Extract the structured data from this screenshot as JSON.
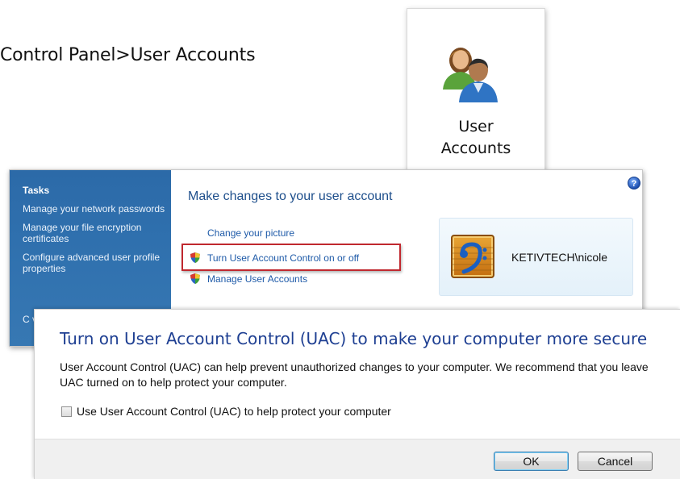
{
  "heading": "Control Panel>User Accounts",
  "tile": {
    "icon": "user-accounts-icon",
    "label_line1": "User",
    "label_line2": "Accounts"
  },
  "control_panel": {
    "sidebar": {
      "title": "Tasks",
      "links": [
        "Manage your network passwords",
        "Manage your file encryption certificates",
        "Configure advanced user profile properties"
      ],
      "clipped_link_partial": "C v"
    },
    "main": {
      "title": "Make changes to your user account",
      "help_icon": "help-icon",
      "links": {
        "change_picture": "Change your picture",
        "turn_uac": "Turn User Account Control on or off",
        "manage_accounts": "Manage User Accounts"
      },
      "account_name": "KETIVTECH\\nicole"
    },
    "colors": {
      "sidebar_blue": "#2f70ae",
      "link_blue": "#1e5aa8",
      "highlight_red": "#c0282f"
    }
  },
  "uac_dialog": {
    "title": "Turn on User Account Control (UAC) to make your computer more secure",
    "description": "User Account Control (UAC) can help prevent unauthorized changes to your computer.  We recommend that you leave UAC turned on to help protect your computer.",
    "checkbox_label": "Use User Account Control (UAC) to help protect your computer",
    "checkbox_checked": false,
    "ok_label": "OK",
    "cancel_label": "Cancel"
  }
}
